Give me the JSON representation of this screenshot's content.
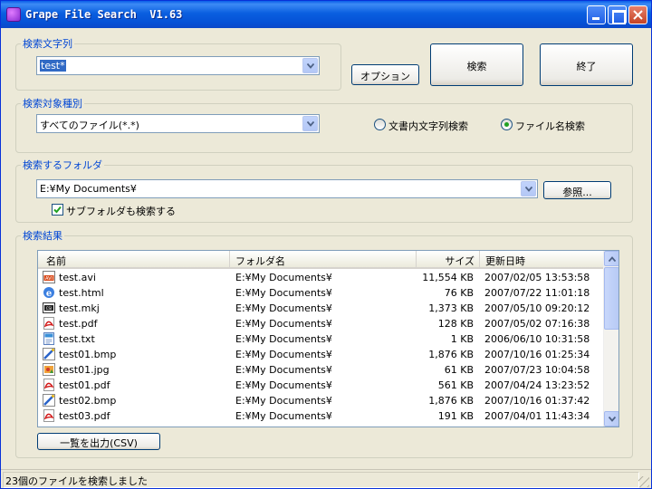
{
  "window": {
    "title": "Grape File Search  V1.63"
  },
  "search_string": {
    "group_label": "検索文字列",
    "value": "test*"
  },
  "buttons": {
    "option": "オプション",
    "search": "検索",
    "exit": "終了",
    "browse": "参照...",
    "export_csv": "一覧を出力(CSV)"
  },
  "target_type": {
    "group_label": "検索対象種別",
    "value": "すべてのファイル(*.*)",
    "radio_content": "文書内文字列検索",
    "radio_filename": "ファイル名検索",
    "selected": "filename"
  },
  "folder": {
    "group_label": "検索するフォルダ",
    "value": "E:¥My Documents¥",
    "include_subfolders_label": "サブフォルダも検索する",
    "include_subfolders": true
  },
  "results": {
    "group_label": "検索結果",
    "columns": [
      "名前",
      "フォルダ名",
      "サイズ",
      "更新日時"
    ],
    "rows": [
      {
        "name": "test.avi",
        "folder": "E:¥My Documents¥",
        "size": "11,554 KB",
        "modified": "2007/02/05 13:53:58",
        "icon": "avi-file-icon"
      },
      {
        "name": "test.html",
        "folder": "E:¥My Documents¥",
        "size": "76 KB",
        "modified": "2007/07/22 11:01:18",
        "icon": "html-file-icon"
      },
      {
        "name": "test.mkj",
        "folder": "E:¥My Documents¥",
        "size": "1,373 KB",
        "modified": "2007/05/10 09:20:12",
        "icon": "mkj-file-icon"
      },
      {
        "name": "test.pdf",
        "folder": "E:¥My Documents¥",
        "size": "128 KB",
        "modified": "2007/05/02 07:16:38",
        "icon": "pdf-file-icon"
      },
      {
        "name": "test.txt",
        "folder": "E:¥My Documents¥",
        "size": "1 KB",
        "modified": "2006/06/10 10:31:58",
        "icon": "txt-file-icon"
      },
      {
        "name": "test01.bmp",
        "folder": "E:¥My Documents¥",
        "size": "1,876 KB",
        "modified": "2007/10/16 01:25:34",
        "icon": "bmp-file-icon"
      },
      {
        "name": "test01.jpg",
        "folder": "E:¥My Documents¥",
        "size": "61 KB",
        "modified": "2007/07/23 10:04:58",
        "icon": "jpg-file-icon"
      },
      {
        "name": "test01.pdf",
        "folder": "E:¥My Documents¥",
        "size": "561 KB",
        "modified": "2007/04/24 13:23:52",
        "icon": "pdf-file-icon"
      },
      {
        "name": "test02.bmp",
        "folder": "E:¥My Documents¥",
        "size": "1,876 KB",
        "modified": "2007/10/16 01:37:42",
        "icon": "bmp-file-icon"
      },
      {
        "name": "test03.pdf",
        "folder": "E:¥My Documents¥",
        "size": "191 KB",
        "modified": "2007/04/01 11:43:34",
        "icon": "pdf-file-icon"
      }
    ]
  },
  "status": {
    "text": "23個のファイルを検索しました"
  },
  "colors": {
    "group_label": "#0046d5",
    "titlebar": "#0a5ee8",
    "selection": "#316ac5"
  }
}
